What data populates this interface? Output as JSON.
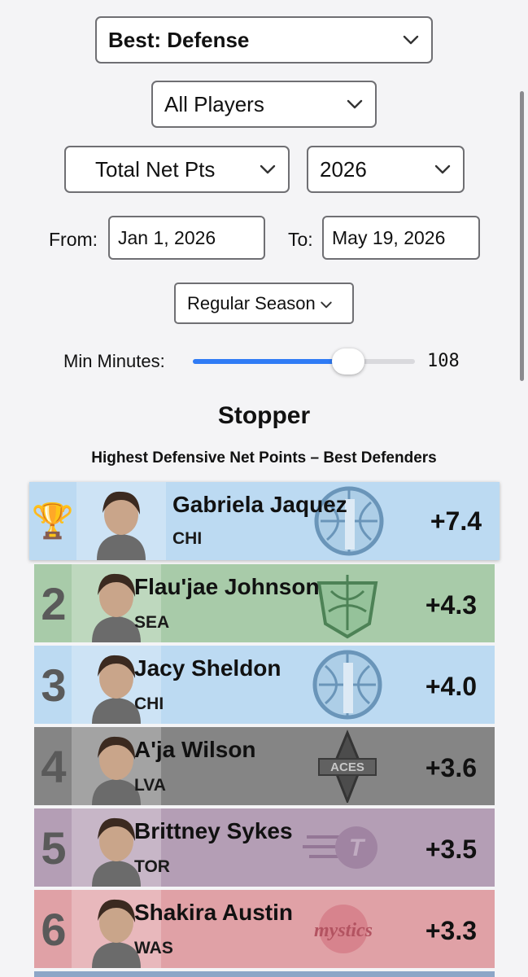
{
  "filters": {
    "category": "Best: Defense",
    "players": "All Players",
    "metric": "Total Net Pts",
    "season_year": "2026",
    "from_label": "From:",
    "from_date": "Jan 1, 2026",
    "to_label": "To:",
    "to_date": "May 19, 2026",
    "season_type": "Regular Season",
    "min_minutes_label": "Min Minutes:",
    "min_minutes_value": "108",
    "min_minutes_fraction": 0.7
  },
  "leaderboard": {
    "title": "Stopper",
    "subtitle": "Highest Defensive Net Points – Best Defenders",
    "rows": [
      {
        "rank": "🏆",
        "name": "Gabriela Jaquez",
        "team": "CHI",
        "value": "+7.4",
        "color": "#bcdaf2",
        "logo": "chicago-sky-logo-icon"
      },
      {
        "rank": "2",
        "name": "Flau'jae Johnson",
        "team": "SEA",
        "value": "+4.3",
        "color": "#a8cba9",
        "logo": "seattle-storm-logo-icon"
      },
      {
        "rank": "3",
        "name": "Jacy Sheldon",
        "team": "CHI",
        "value": "+4.0",
        "color": "#bcdaf2",
        "logo": "chicago-sky-logo-icon"
      },
      {
        "rank": "4",
        "name": "A'ja Wilson",
        "team": "LVA",
        "value": "+3.6",
        "color": "#858585",
        "logo": "las-vegas-aces-logo-icon"
      },
      {
        "rank": "5",
        "name": "Brittney Sykes",
        "team": "TOR",
        "value": "+3.5",
        "color": "#b49eb5",
        "logo": "toronto-tempo-logo-icon"
      },
      {
        "rank": "6",
        "name": "Shakira Austin",
        "team": "WAS",
        "value": "+3.3",
        "color": "#e0a1a6",
        "logo": "washington-mystics-logo-icon"
      }
    ]
  }
}
